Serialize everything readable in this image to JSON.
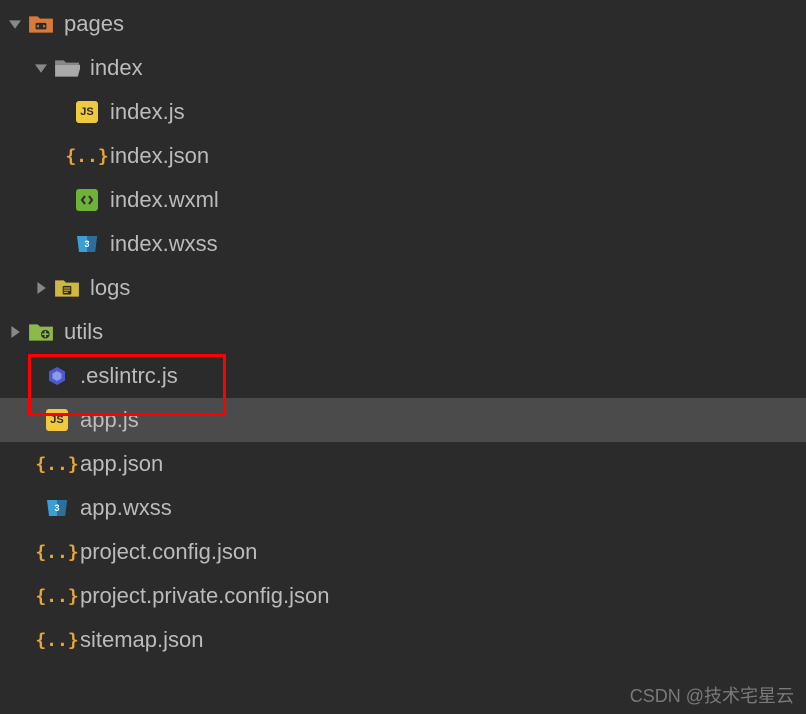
{
  "tree": {
    "pages": {
      "label": "pages",
      "index": {
        "label": "index",
        "files": {
          "index_js": "index.js",
          "index_json": "index.json",
          "index_wxml": "index.wxml",
          "index_wxss": "index.wxss"
        }
      },
      "logs": {
        "label": "logs"
      }
    },
    "utils": {
      "label": "utils"
    },
    "root_files": {
      "eslintrc": ".eslintrc.js",
      "app_js": "app.js",
      "app_json": "app.json",
      "app_wxss": "app.wxss",
      "project_config": "project.config.json",
      "project_private_config": "project.private.config.json",
      "sitemap": "sitemap.json"
    }
  },
  "watermark": "CSDN @技术宅星云"
}
